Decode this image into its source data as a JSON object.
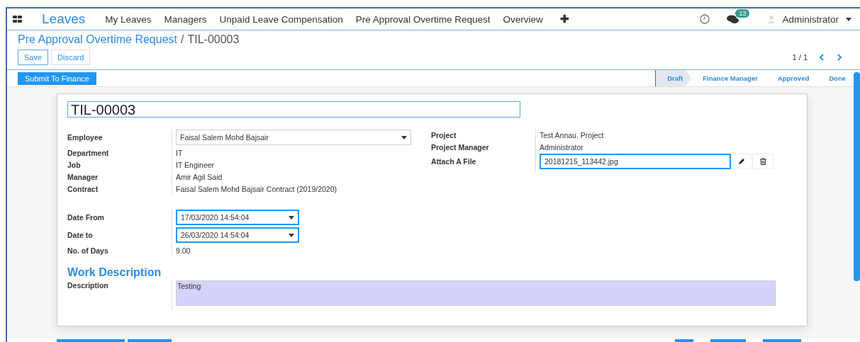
{
  "navbar": {
    "app_title": "Leaves",
    "menu": [
      "My Leaves",
      "Managers",
      "Unpaid Leave Compensation",
      "Pre Approval Overtime Request",
      "Overview"
    ],
    "add_label": "✚",
    "message_count": "13",
    "user": "Administrator"
  },
  "breadcrumb": {
    "parent": "Pre Approval Overtime Request",
    "separator": "/",
    "current": "TIL-00003"
  },
  "buttons": [
    "Save",
    "Discard"
  ],
  "pager": "1 / 1",
  "action_button": "Submit To Finance",
  "stages": [
    {
      "label": "Draft",
      "selected": true
    },
    {
      "label": "Finance Manager",
      "selected": false
    },
    {
      "label": "Approved",
      "selected": false
    },
    {
      "label": "Done",
      "selected": false
    }
  ],
  "form": {
    "name": "TIL-00003",
    "left_fields": [
      {
        "label": "Employee",
        "value": "Faisal Salem Mohd Bajsair",
        "kind": "select"
      },
      {
        "label": "Department",
        "value": "IT",
        "kind": "text"
      },
      {
        "label": "Job",
        "value": "IT Engineer",
        "kind": "text"
      },
      {
        "label": "Manager",
        "value": "Amir Agil Said",
        "kind": "text"
      },
      {
        "label": "Contract",
        "value": "Faisal Salem Mohd Bajsair Contract (2019/2020)",
        "kind": "text"
      }
    ],
    "right_fields": [
      {
        "label": "Project",
        "value": "Test Annau. Project",
        "kind": "text"
      },
      {
        "label": "Project Manager",
        "value": "Administrator",
        "kind": "text"
      },
      {
        "label": "Attach A File",
        "value": "20181215_113442.jpg",
        "kind": "file"
      }
    ],
    "date_fields": [
      {
        "label": "Date From",
        "value": "17/03/2020 14:54:04",
        "kind": "date"
      },
      {
        "label": "Date to",
        "value": "26/03/2020 14:54:04",
        "kind": "date"
      },
      {
        "label": "No. of Days",
        "value": "9.00",
        "kind": "text"
      }
    ],
    "section_title": "Work Description",
    "description": {
      "label": "Description",
      "value": "Testing"
    }
  }
}
